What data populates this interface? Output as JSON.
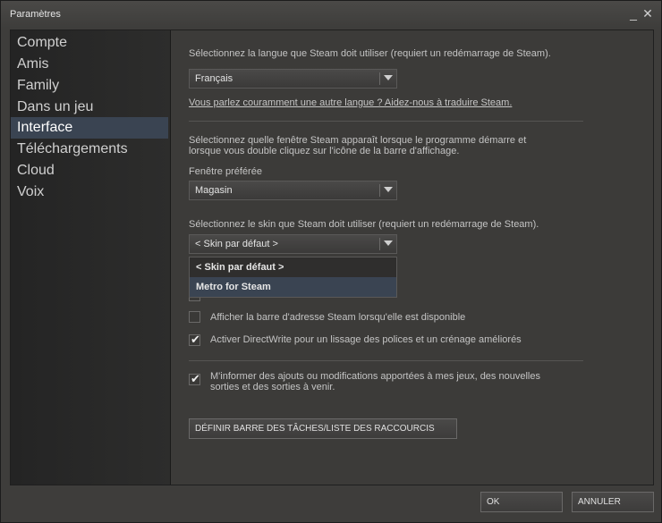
{
  "window": {
    "title": "Paramètres",
    "minimize_glyph": "_",
    "close_glyph": "✕"
  },
  "sidebar": {
    "items": [
      {
        "label": "Compte",
        "active": false
      },
      {
        "label": "Amis",
        "active": false
      },
      {
        "label": "Family",
        "active": false
      },
      {
        "label": "Dans un jeu",
        "active": false
      },
      {
        "label": "Interface",
        "active": true
      },
      {
        "label": "Téléchargements",
        "active": false
      },
      {
        "label": "Cloud",
        "active": false
      },
      {
        "label": "Voix",
        "active": false
      }
    ]
  },
  "language": {
    "label": "Sélectionnez la langue que Steam doit utiliser (requiert un redémarrage de Steam).",
    "selected": "Français",
    "help_link": "Vous parlez couramment une autre langue ? Aidez-nous à traduire Steam."
  },
  "window_pref": {
    "description_line1": "Sélectionnez quelle fenêtre Steam apparaît lorsque le programme démarre et",
    "description_line2": "lorsque vous double cliquez sur l'icône de la barre d'affichage.",
    "label": "Fenêtre préférée",
    "selected": "Magasin"
  },
  "skin": {
    "label": "Sélectionnez le skin que Steam doit utiliser (requiert un redémarrage de Steam).",
    "selected": "< Skin par défaut >",
    "options": [
      "< Skin par défaut >",
      "Metro for Steam"
    ],
    "hovered_option": "Metro for Steam"
  },
  "checkboxes": [
    {
      "label": "Afficher la barre d'adresse Steam lorsqu'elle est disponible",
      "checked": false
    },
    {
      "label": "Activer DirectWrite pour un lissage des polices et un crénage améliorés",
      "checked": true
    },
    {
      "label_line1": "M'informer des ajouts ou modifications apportées à mes jeux, des nouvelles",
      "label_line2": "sorties et des sorties à venir.",
      "checked": true
    }
  ],
  "taskbar_button": "DÉFINIR BARRE DES TÂCHES/LISTE DES RACCOURCIS",
  "footer": {
    "ok": "OK",
    "cancel": "ANNULER"
  },
  "icons": {
    "check": "✔"
  },
  "colors": {
    "selection": "#3a4452",
    "background": "#3e3d3b",
    "sidebar": "#2a2a29"
  }
}
